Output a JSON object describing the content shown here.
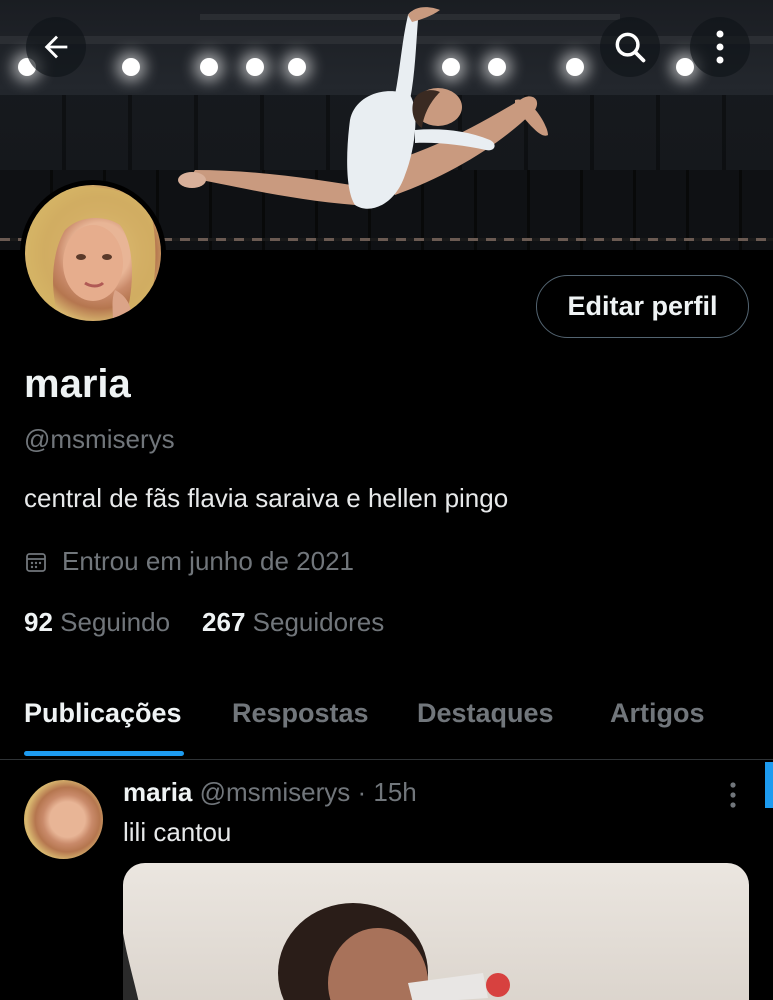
{
  "profile": {
    "name": "maria",
    "handle": "@msmiserys",
    "bio": "central de fãs flavia saraiva e hellen pingo",
    "joined": "Entrou em junho de 2021",
    "following_count": "92",
    "following_label": "Seguindo",
    "followers_count": "267",
    "followers_label": "Seguidores",
    "edit_button": "Editar perfil"
  },
  "tabs": [
    {
      "label": "Publicações",
      "active": true
    },
    {
      "label": "Respostas",
      "active": false
    },
    {
      "label": "Destaques",
      "active": false
    },
    {
      "label": "Artigos",
      "active": false
    }
  ],
  "post": {
    "name": "maria",
    "handle": "@msmiserys",
    "separator": "·",
    "time": "15h",
    "text": "lili cantou"
  },
  "icons": {
    "back": "arrow-left-icon",
    "search": "search-icon",
    "more": "more-vertical-icon",
    "calendar": "calendar-icon"
  },
  "colors": {
    "accent": "#1d9bf0",
    "background": "#000000",
    "secondary_text": "#71767b"
  }
}
